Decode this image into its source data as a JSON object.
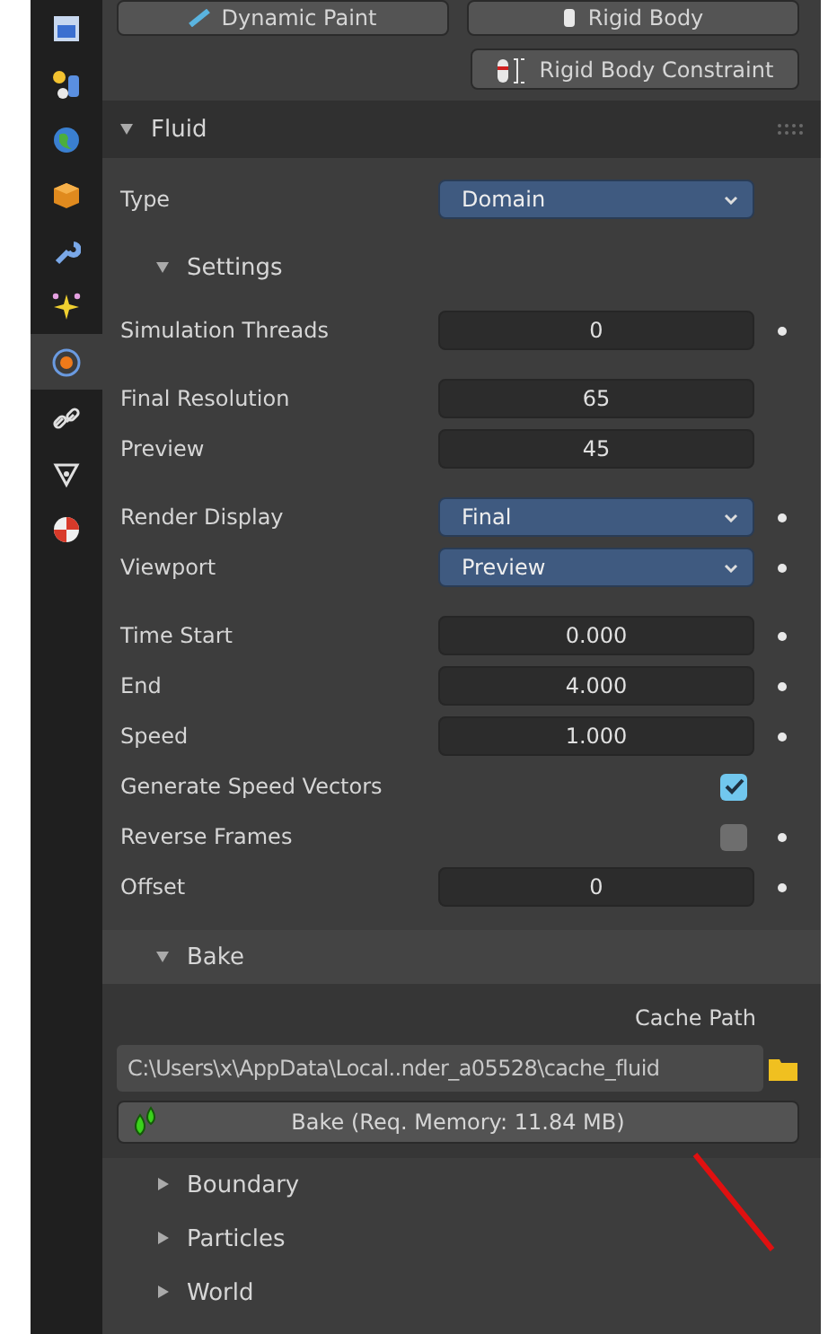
{
  "top_buttons": [
    {
      "label": "Dynamic Paint",
      "kind": "paint"
    },
    {
      "label": "Rigid Body",
      "kind": "rigid"
    }
  ],
  "constraint_button": {
    "label": "Rigid Body Constraint"
  },
  "sidebar": {
    "tabs": [
      {
        "kind": "render",
        "selected": false
      },
      {
        "kind": "particles",
        "selected": false
      },
      {
        "kind": "world",
        "selected": false
      },
      {
        "kind": "object",
        "selected": false
      },
      {
        "kind": "wrench",
        "selected": false
      },
      {
        "kind": "sparkle",
        "selected": false
      },
      {
        "kind": "physics",
        "selected": true
      },
      {
        "kind": "link",
        "selected": false
      },
      {
        "kind": "mesh",
        "selected": false
      },
      {
        "kind": "material",
        "selected": false
      }
    ]
  },
  "fluid_panel": {
    "title": "Fluid",
    "expanded": true,
    "type_row": {
      "label": "Type",
      "value": "Domain"
    },
    "settings": {
      "title": "Settings",
      "expanded": true,
      "groups": [
        [
          {
            "label": "Simulation Threads",
            "kind": "number",
            "value": "0",
            "animatable": true
          }
        ],
        [
          {
            "label": "Final Resolution",
            "kind": "number",
            "value": "65",
            "animatable": false
          },
          {
            "label": "Preview",
            "kind": "number",
            "value": "45",
            "animatable": false
          }
        ],
        [
          {
            "label": "Render Display",
            "kind": "dropdown",
            "value": "Final",
            "animatable": true
          },
          {
            "label": "Viewport",
            "kind": "dropdown",
            "value": "Preview",
            "animatable": true
          }
        ],
        [
          {
            "label": "Time Start",
            "kind": "number",
            "value": "0.000",
            "animatable": true
          },
          {
            "label": "End",
            "kind": "number",
            "value": "4.000",
            "animatable": true
          },
          {
            "label": "Speed",
            "kind": "number",
            "value": "1.000",
            "animatable": true
          },
          {
            "label": "Generate Speed Vectors",
            "kind": "checkbox",
            "checked": true,
            "animatable": false
          },
          {
            "label": "Reverse Frames",
            "kind": "checkbox",
            "checked": false,
            "animatable": true
          },
          {
            "label": "Offset",
            "kind": "number",
            "value": "0",
            "animatable": true
          }
        ]
      ]
    },
    "bake": {
      "title": "Bake",
      "expanded": true,
      "cache_label": "Cache Path",
      "cache_path": "C:\\Users\\x\\AppData\\Local..nder_a05528\\cache_fluid",
      "bake_button": "Bake (Req. Memory: 11.84 MB)"
    },
    "subpanels": [
      {
        "title": "Boundary",
        "expanded": false
      },
      {
        "title": "Particles",
        "expanded": false
      },
      {
        "title": "World",
        "expanded": false
      }
    ]
  }
}
